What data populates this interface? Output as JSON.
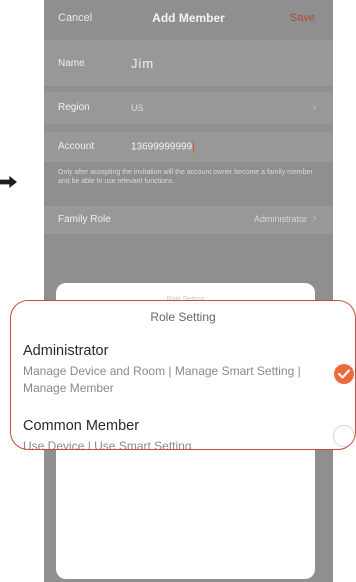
{
  "nav": {
    "cancel": "Cancel",
    "title": "Add Member",
    "save": "Save"
  },
  "form": {
    "name_label": "Name",
    "name_value": "Jim",
    "region_label": "Region",
    "region_value": "US",
    "account_label": "Account",
    "account_value": "13699999999",
    "note": "Only after accepting the invitation will the account owner become a family member and be able to use relevant functions.",
    "family_role_label": "Family Role",
    "family_role_value": "Administrator"
  },
  "sheet": {
    "title_faint": "Role Setting"
  },
  "callout": {
    "title": "Role Setting",
    "options": [
      {
        "name": "Administrator",
        "desc": "Manage Device and Room | Manage Smart Setting | Manage Member",
        "selected": true
      },
      {
        "name": "Common Member",
        "desc": "Use Device | Use Smart Setting",
        "selected": false
      }
    ]
  },
  "colors": {
    "accent": "#ec6a3c",
    "callout_border": "#c84b3b",
    "overlay": "#8f8f8f"
  },
  "icons": {
    "arrow": "arrow-right-icon",
    "chevron": "chevron-right-icon",
    "check": "check-circle-icon",
    "radio": "radio-empty-icon"
  }
}
